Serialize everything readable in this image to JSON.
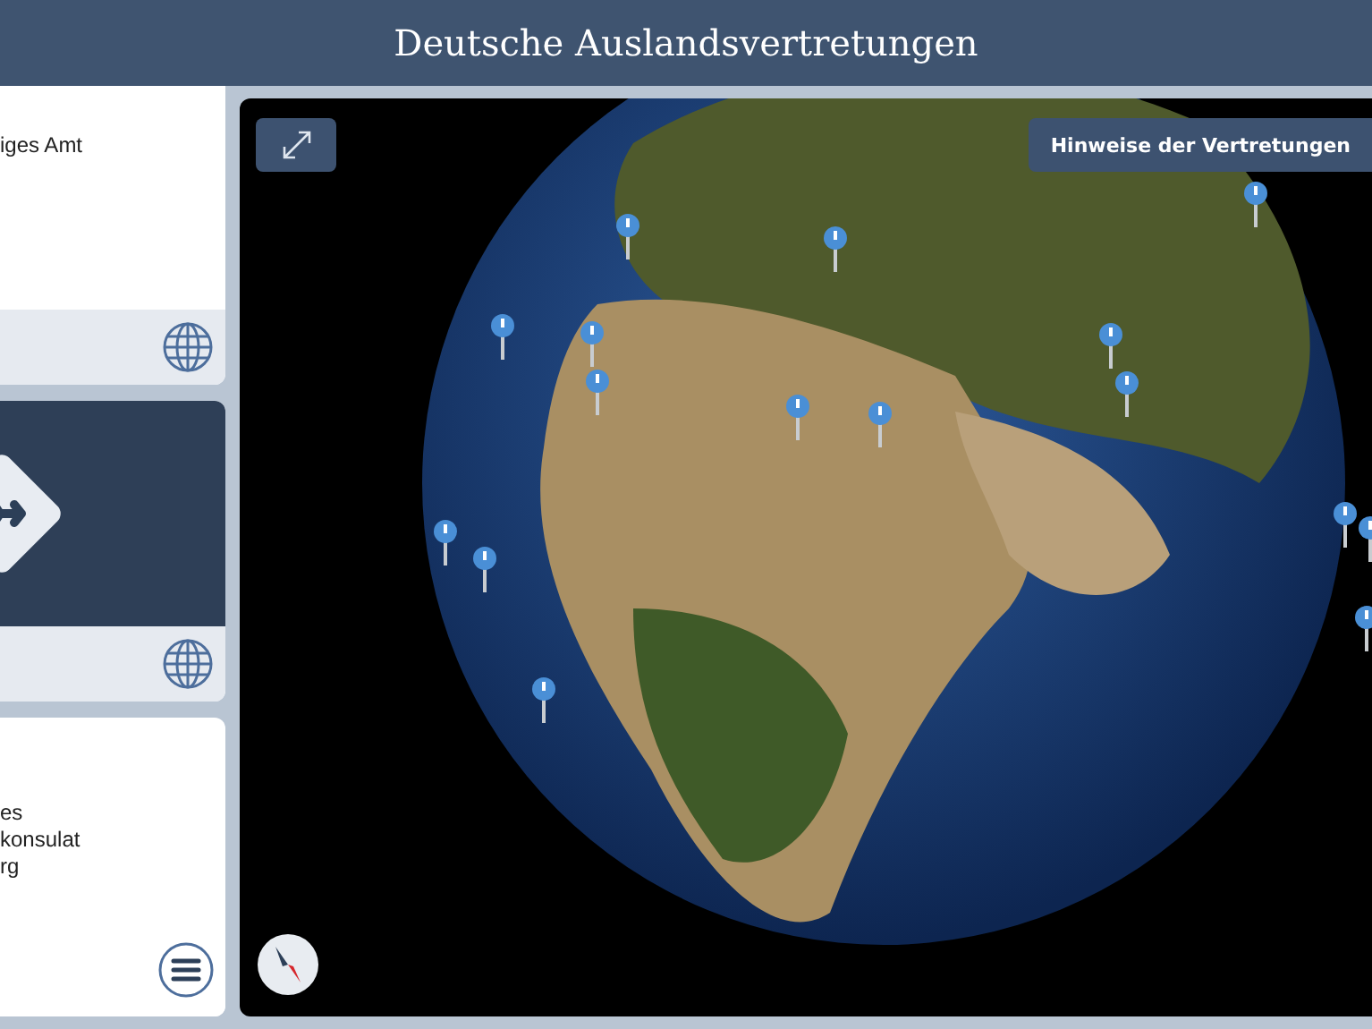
{
  "header": {
    "title": "Deutsche Auslandsvertretungen"
  },
  "cards": [
    {
      "kind": "text",
      "lines": [
        "iges Amt"
      ],
      "footer": {
        "kind": "globe"
      }
    },
    {
      "kind": "travel",
      "footer": {
        "kind": "globe"
      }
    },
    {
      "kind": "text",
      "lines": [
        "es",
        "konsulat",
        "rg"
      ],
      "footer": {
        "kind": "menu"
      }
    }
  ],
  "map": {
    "notes_button": "Hinweise der Vertretungen"
  }
}
